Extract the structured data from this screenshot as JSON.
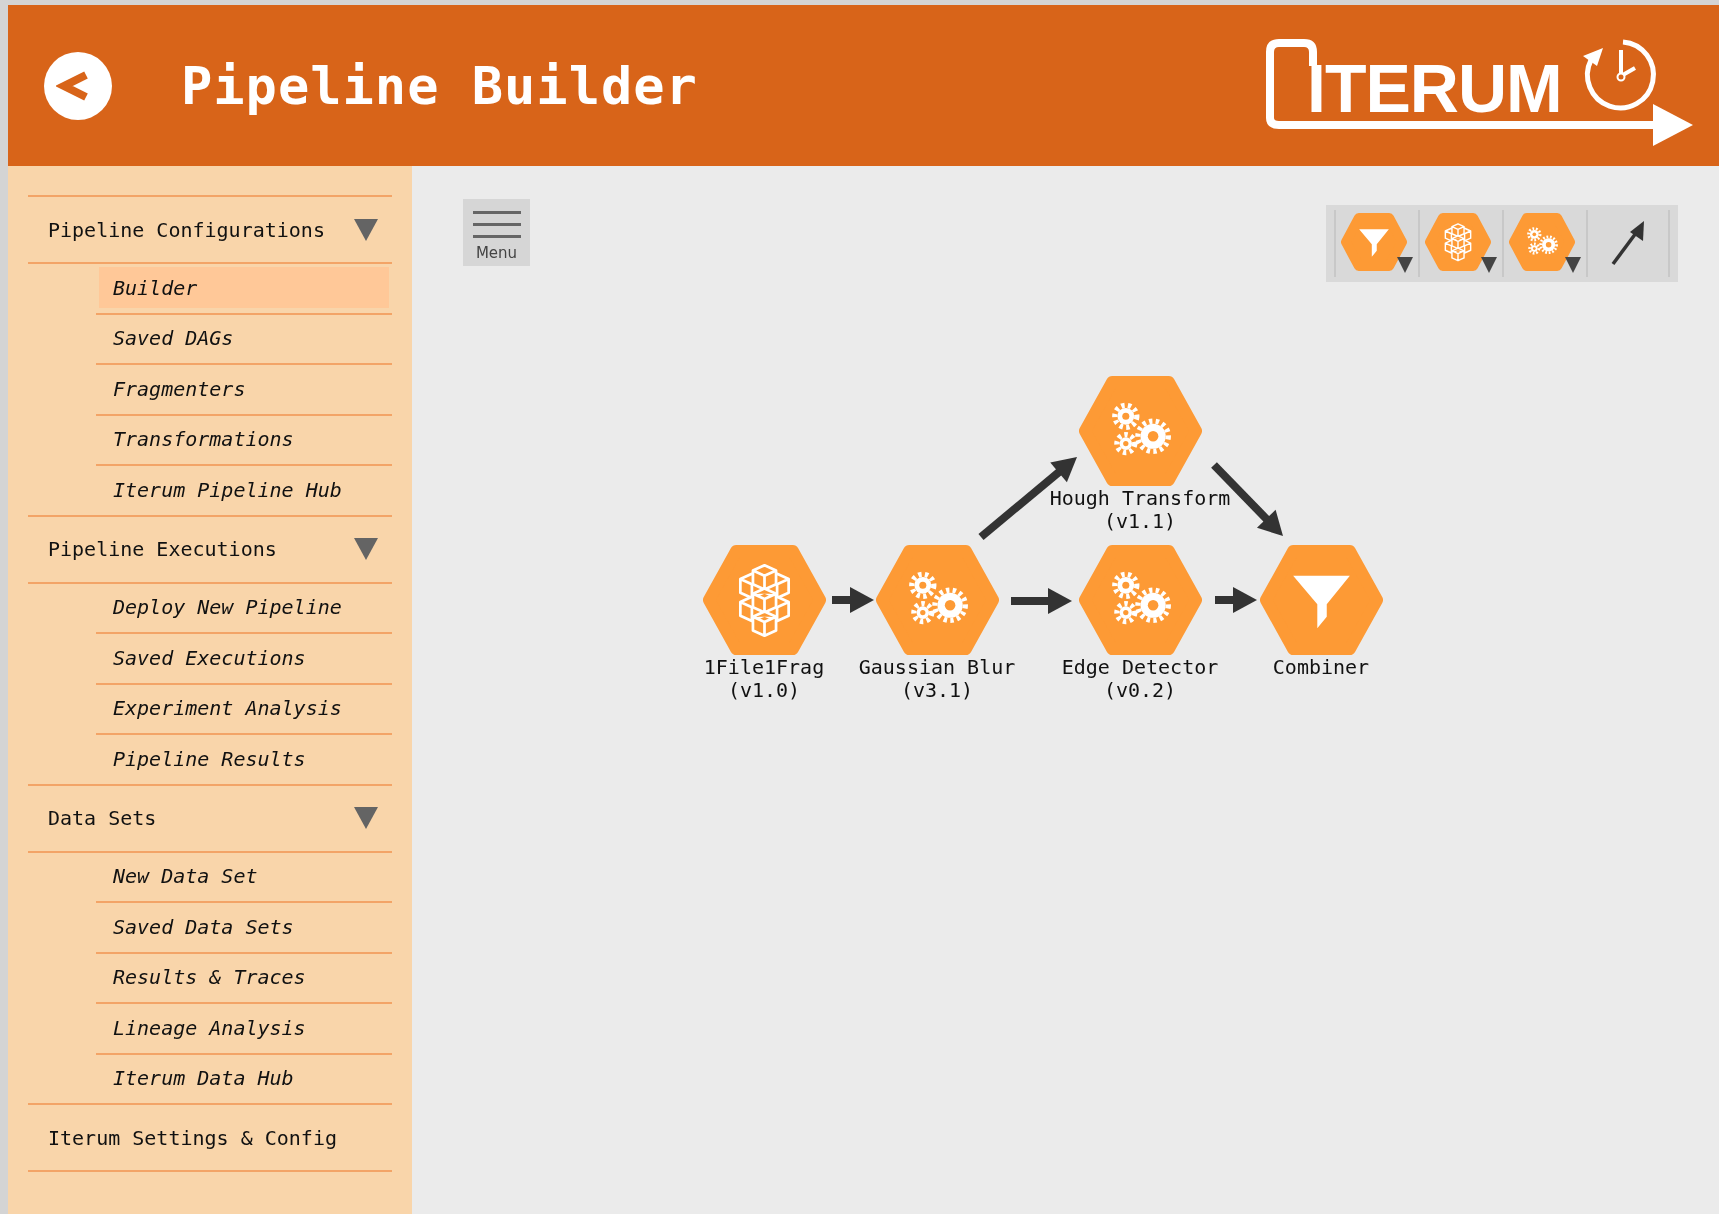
{
  "header": {
    "title": "Pipeline Builder",
    "logo_text": "ITERUM"
  },
  "sidebar": {
    "sections": [
      {
        "label": "Pipeline Configurations",
        "expanded": true,
        "children": [
          {
            "label": "Builder",
            "selected": true
          },
          {
            "label": "Saved DAGs",
            "selected": false
          },
          {
            "label": "Fragmenters",
            "selected": false
          },
          {
            "label": "Transformations",
            "selected": false
          },
          {
            "label": "Iterum Pipeline Hub",
            "selected": false
          }
        ]
      },
      {
        "label": "Pipeline Executions",
        "expanded": true,
        "children": [
          {
            "label": "Deploy New Pipeline",
            "selected": false
          },
          {
            "label": "Saved Executions",
            "selected": false
          },
          {
            "label": "Experiment Analysis",
            "selected": false
          },
          {
            "label": "Pipeline Results",
            "selected": false
          }
        ]
      },
      {
        "label": "Data Sets",
        "expanded": true,
        "children": [
          {
            "label": "New Data Set",
            "selected": false
          },
          {
            "label": "Saved Data Sets",
            "selected": false
          },
          {
            "label": "Results & Traces",
            "selected": false
          },
          {
            "label": "Lineage Analysis",
            "selected": false
          },
          {
            "label": "Iterum Data Hub",
            "selected": false
          }
        ]
      },
      {
        "label": "Iterum Settings & Config"
      }
    ]
  },
  "canvas": {
    "menu_label": "Menu",
    "toolbar": [
      {
        "kind": "combiner"
      },
      {
        "kind": "fragmenter"
      },
      {
        "kind": "transformation"
      },
      {
        "kind": "edge"
      }
    ],
    "nodes": [
      {
        "kind": "transformation",
        "name": "Hough Transform",
        "version": "(v1.1)"
      },
      {
        "kind": "fragmenter",
        "name": "1File1Frag",
        "version": "(v1.0)"
      },
      {
        "kind": "transformation",
        "name": "Gaussian Blur",
        "version": "(v3.1)"
      },
      {
        "kind": "transformation",
        "name": "Edge Detector",
        "version": "(v0.2)"
      },
      {
        "kind": "combiner",
        "name": "Combiner"
      }
    ]
  }
}
